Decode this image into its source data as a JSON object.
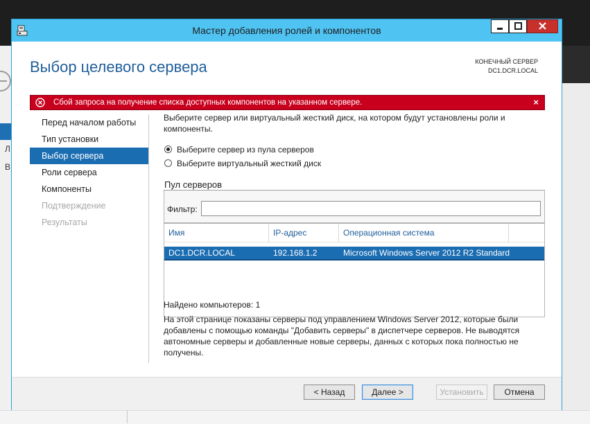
{
  "background": {
    "left_letters": [
      "Л",
      "В"
    ]
  },
  "window": {
    "title": "Мастер добавления ролей и компонентов",
    "accent_color": "#4fc3f2"
  },
  "header": {
    "title": "Выбор целевого сервера",
    "destination_label": "КОНЕЧНЫЙ СЕРВЕР",
    "destination_server": "DC1.DCR.LOCAL"
  },
  "error": {
    "message": "Сбой запроса на получение списка доступных компонентов на указанном сервере.",
    "close_glyph": "×",
    "color": "#c8001e"
  },
  "nav": {
    "items": [
      {
        "label": "Перед началом работы",
        "state": "normal"
      },
      {
        "label": "Тип установки",
        "state": "normal"
      },
      {
        "label": "Выбор сервера",
        "state": "active"
      },
      {
        "label": "Роли сервера",
        "state": "normal"
      },
      {
        "label": "Компоненты",
        "state": "normal"
      },
      {
        "label": "Подтверждение",
        "state": "disabled"
      },
      {
        "label": "Результаты",
        "state": "disabled"
      }
    ]
  },
  "content": {
    "description": "Выберите сервер или виртуальный жесткий диск, на котором будут установлены роли и компоненты.",
    "options": [
      {
        "label": "Выберите сервер из пула серверов",
        "checked": true
      },
      {
        "label": "Выберите виртуальный жесткий диск",
        "checked": false
      }
    ],
    "pool_label": "Пул серверов",
    "filter_label": "Фильтр:",
    "filter_value": "",
    "columns": [
      "Имя",
      "IP-адрес",
      "Операционная система"
    ],
    "rows": [
      {
        "name": "DC1.DCR.LOCAL",
        "ip": "192.168.1.2",
        "os": "Microsoft Windows Server 2012 R2 Standard"
      }
    ],
    "found": "Найдено компьютеров: 1",
    "info": "На этой странице показаны серверы под управлением Windows Server 2012, которые были добавлены с помощью команды \"Добавить серверы\" в диспетчере серверов. Не выводятся автономные серверы и добавленные новые серверы, данных с которых пока полностью не получены."
  },
  "buttons": {
    "back": "< Назад",
    "next": "Далее >",
    "install": "Установить",
    "cancel": "Отмена"
  }
}
